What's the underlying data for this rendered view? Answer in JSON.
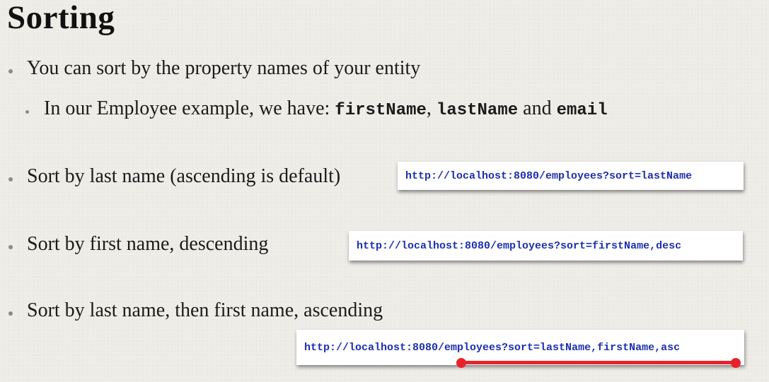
{
  "slide": {
    "title": "Sorting",
    "bullet1": "You can sort by the property names of your entity",
    "sub_bullet": {
      "prefix": "In our Employee example, we have: ",
      "field1": "firstName",
      "sep1": ", ",
      "field2": "lastName",
      "sep2": " and ",
      "field3": "email"
    },
    "examples": [
      {
        "label": "Sort by last name (ascending is default)",
        "url": "http://localhost:8080/employees?sort=lastName"
      },
      {
        "label": "Sort by first name, descending",
        "url": "http://localhost:8080/employees?sort=firstName,desc"
      },
      {
        "label": "Sort by last name, then first name, ascending",
        "url": "http://localhost:8080/employees?sort=lastName,firstName,asc"
      }
    ],
    "colors": {
      "url_text": "#1d2fb0",
      "highlight": "#e8222a",
      "background": "#efede8"
    }
  }
}
